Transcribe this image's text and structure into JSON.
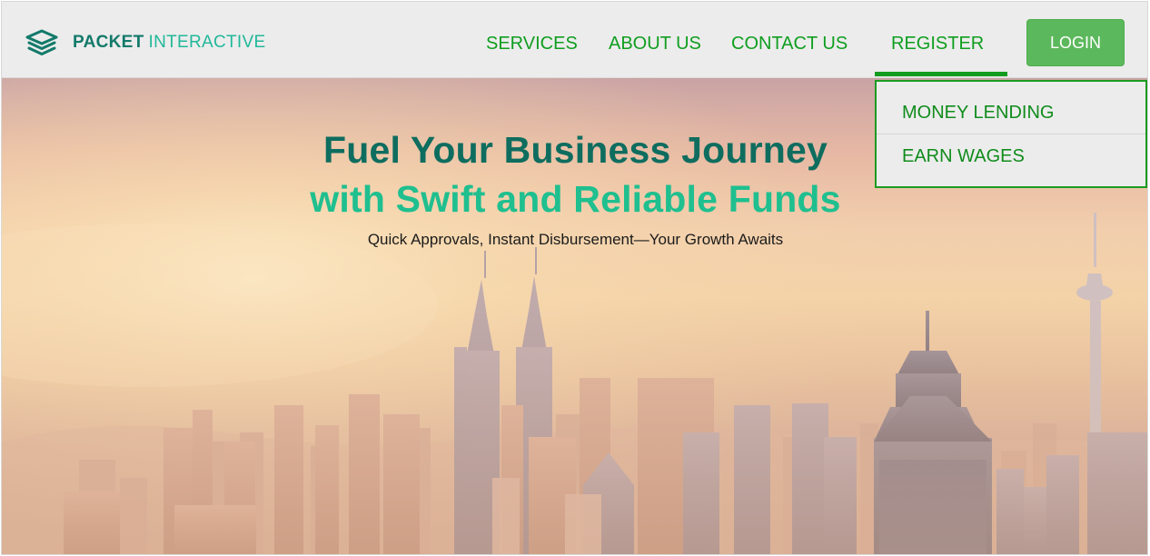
{
  "brand": {
    "name_bold": "PACKET",
    "name_light": "INTERACTIVE"
  },
  "nav": {
    "services": "SERVICES",
    "about": "ABOUT US",
    "contact": "CONTACT US",
    "register": "REGISTER",
    "login": "LOGIN",
    "active": "REGISTER"
  },
  "register_menu": {
    "items": [
      {
        "label": "MONEY LENDING"
      },
      {
        "label": "EARN WAGES"
      }
    ]
  },
  "hero": {
    "headline_line1": "Fuel Your Business Journey",
    "headline_line2": "with Swift and Reliable Funds",
    "subheadline": "Quick Approvals, Instant Disbursement—Your Growth Awaits",
    "background": "city-skyline-sunset-image"
  },
  "colors": {
    "nav_green": "#0f9e1f",
    "login_button": "#5cb85c",
    "headline_dark": "#0e6d5f",
    "headline_light": "#1fbf8f",
    "brand_dark": "#137a6a",
    "brand_light": "#21b89a"
  }
}
